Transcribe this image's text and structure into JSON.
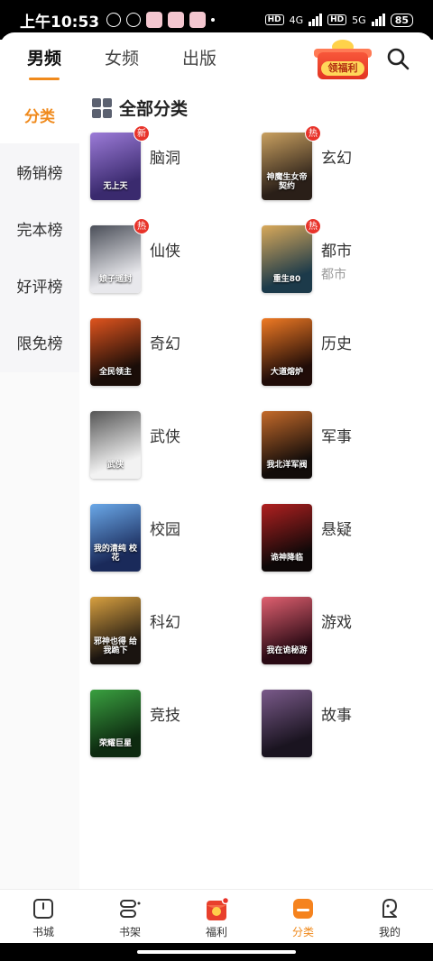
{
  "status": {
    "time": "上午10:53",
    "net1": "4G",
    "net2": "5G",
    "battery": "85",
    "hd": "HD"
  },
  "tabs": [
    {
      "label": "男频",
      "active": true
    },
    {
      "label": "女频",
      "active": false
    },
    {
      "label": "出版",
      "active": false
    }
  ],
  "promo": {
    "label": "领福利"
  },
  "sidebar": {
    "items": [
      {
        "label": "分类",
        "active": true
      },
      {
        "label": "畅销榜",
        "active": false
      },
      {
        "label": "完本榜",
        "active": false
      },
      {
        "label": "好评榜",
        "active": false
      },
      {
        "label": "限免榜",
        "active": false
      }
    ]
  },
  "main": {
    "title": "全部分类",
    "categories": [
      {
        "name": "脑洞",
        "badge": "新",
        "sub": "",
        "cover_text": "无上天",
        "colors": [
          "#3a2a6e",
          "#9c7bd8"
        ]
      },
      {
        "name": "玄幻",
        "badge": "热",
        "sub": "",
        "cover_text": "神魔生女帝 契约",
        "colors": [
          "#2a1f18",
          "#c9a060"
        ]
      },
      {
        "name": "仙侠",
        "badge": "热",
        "sub": "",
        "cover_text": "娘子遥封",
        "colors": [
          "#e8e8ec",
          "#4a4e58"
        ]
      },
      {
        "name": "都市",
        "badge": "热",
        "sub": "都市",
        "cover_text": "重生80",
        "colors": [
          "#1c3a4a",
          "#d9a95a"
        ]
      },
      {
        "name": "奇幻",
        "badge": "",
        "sub": "",
        "cover_text": "全民领主",
        "colors": [
          "#1a0d08",
          "#e0541e"
        ]
      },
      {
        "name": "历史",
        "badge": "",
        "sub": "",
        "cover_text": "大道熔炉",
        "colors": [
          "#200c08",
          "#f07a24"
        ]
      },
      {
        "name": "武侠",
        "badge": "",
        "sub": "",
        "cover_text": "武侠",
        "colors": [
          "#f2f2f2",
          "#555555"
        ]
      },
      {
        "name": "军事",
        "badge": "",
        "sub": "",
        "cover_text": "我北洋军阀",
        "colors": [
          "#120c0a",
          "#c46a2a"
        ]
      },
      {
        "name": "校园",
        "badge": "",
        "sub": "",
        "cover_text": "我的清纯 校花",
        "colors": [
          "#1a2a5a",
          "#6aa8e8"
        ]
      },
      {
        "name": "悬疑",
        "badge": "",
        "sub": "",
        "cover_text": "诡神降临",
        "colors": [
          "#0e0808",
          "#b02020"
        ]
      },
      {
        "name": "科幻",
        "badge": "",
        "sub": "",
        "cover_text": "邪神也得 给我跪下",
        "colors": [
          "#1a1410",
          "#d8a040"
        ]
      },
      {
        "name": "游戏",
        "badge": "",
        "sub": "",
        "cover_text": "我在诡秘游",
        "colors": [
          "#2a0a14",
          "#e06070"
        ]
      },
      {
        "name": "竞技",
        "badge": "",
        "sub": "",
        "cover_text": "荣耀巨星",
        "colors": [
          "#0d2a10",
          "#3aa040"
        ]
      },
      {
        "name": "故事",
        "badge": "",
        "sub": "",
        "cover_text": "",
        "colors": [
          "#1a1420",
          "#7a5a8a"
        ]
      }
    ]
  },
  "bottom_nav": [
    {
      "label": "书城",
      "icon": "bookstore-icon",
      "active": false
    },
    {
      "label": "书架",
      "icon": "bookshelf-icon",
      "active": false
    },
    {
      "label": "福利",
      "icon": "gift-envelope-icon",
      "active": false
    },
    {
      "label": "分类",
      "icon": "category-icon",
      "active": true
    },
    {
      "label": "我的",
      "icon": "profile-icon",
      "active": false
    }
  ],
  "colors": {
    "accent": "#f08a1c",
    "badge": "#e8332a"
  }
}
